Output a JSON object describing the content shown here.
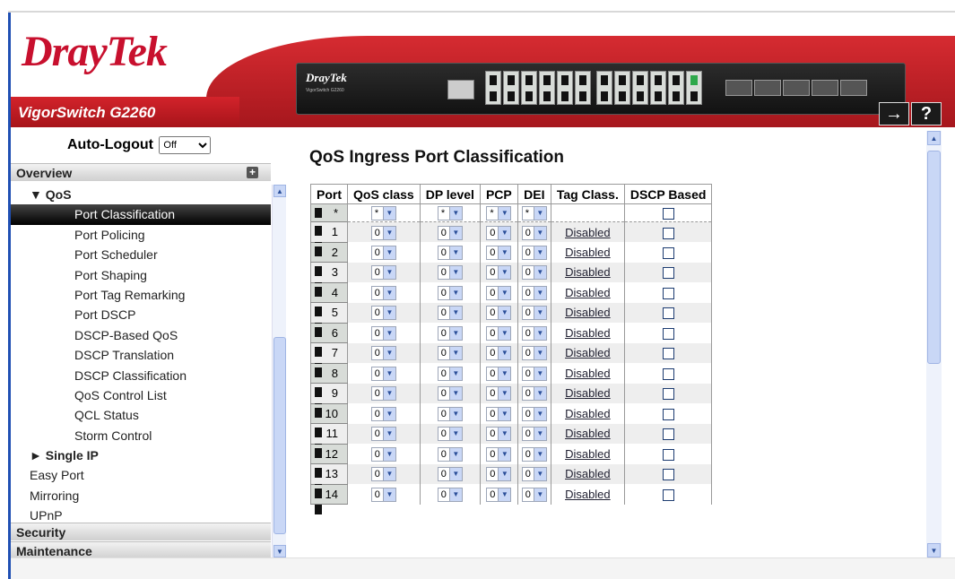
{
  "header": {
    "logo_dray": "Dray",
    "logo_tek": "Tek",
    "model": "VigorSwitch G2260",
    "device_brand": "DrayTek",
    "device_sub": "VigorSwitch G2260",
    "logout_icon": "→",
    "help_label": "?"
  },
  "nav": {
    "autologout_label": "Auto-Logout",
    "autologout_value": "Off",
    "overview_label": "Overview",
    "security_label": "Security",
    "maintenance_label": "Maintenance",
    "items": [
      {
        "label": "▼ QoS",
        "level": 1
      },
      {
        "label": "Port Classification",
        "level": 2,
        "active": true
      },
      {
        "label": "Port Policing",
        "level": 2
      },
      {
        "label": "Port Scheduler",
        "level": 2
      },
      {
        "label": "Port Shaping",
        "level": 2
      },
      {
        "label": "Port Tag Remarking",
        "level": 2
      },
      {
        "label": "Port DSCP",
        "level": 2
      },
      {
        "label": "DSCP-Based QoS",
        "level": 2
      },
      {
        "label": "DSCP Translation",
        "level": 2
      },
      {
        "label": "DSCP Classification",
        "level": 2
      },
      {
        "label": "QoS Control List",
        "level": 2
      },
      {
        "label": "QCL Status",
        "level": 2
      },
      {
        "label": "Storm Control",
        "level": 2
      },
      {
        "label": "► Single IP",
        "level": 1
      },
      {
        "label": "Easy Port",
        "level": 0
      },
      {
        "label": "Mirroring",
        "level": 0
      },
      {
        "label": "UPnP",
        "level": 0
      }
    ]
  },
  "main": {
    "title": "QoS Ingress Port Classification",
    "columns": [
      "Port",
      "QoS class",
      "DP level",
      "PCP",
      "DEI",
      "Tag Class.",
      "DSCP Based"
    ],
    "star_row": {
      "port": "*",
      "qos": "*",
      "dp": "*",
      "pcp": "*",
      "dei": "*"
    },
    "rows": [
      {
        "port": "1",
        "qos": "0",
        "dp": "0",
        "pcp": "0",
        "dei": "0",
        "tag": "Disabled"
      },
      {
        "port": "2",
        "qos": "0",
        "dp": "0",
        "pcp": "0",
        "dei": "0",
        "tag": "Disabled"
      },
      {
        "port": "3",
        "qos": "0",
        "dp": "0",
        "pcp": "0",
        "dei": "0",
        "tag": "Disabled"
      },
      {
        "port": "4",
        "qos": "0",
        "dp": "0",
        "pcp": "0",
        "dei": "0",
        "tag": "Disabled"
      },
      {
        "port": "5",
        "qos": "0",
        "dp": "0",
        "pcp": "0",
        "dei": "0",
        "tag": "Disabled"
      },
      {
        "port": "6",
        "qos": "0",
        "dp": "0",
        "pcp": "0",
        "dei": "0",
        "tag": "Disabled"
      },
      {
        "port": "7",
        "qos": "0",
        "dp": "0",
        "pcp": "0",
        "dei": "0",
        "tag": "Disabled"
      },
      {
        "port": "8",
        "qos": "0",
        "dp": "0",
        "pcp": "0",
        "dei": "0",
        "tag": "Disabled"
      },
      {
        "port": "9",
        "qos": "0",
        "dp": "0",
        "pcp": "0",
        "dei": "0",
        "tag": "Disabled"
      },
      {
        "port": "10",
        "qos": "0",
        "dp": "0",
        "pcp": "0",
        "dei": "0",
        "tag": "Disabled"
      },
      {
        "port": "11",
        "qos": "0",
        "dp": "0",
        "pcp": "0",
        "dei": "0",
        "tag": "Disabled"
      },
      {
        "port": "12",
        "qos": "0",
        "dp": "0",
        "pcp": "0",
        "dei": "0",
        "tag": "Disabled"
      },
      {
        "port": "13",
        "qos": "0",
        "dp": "0",
        "pcp": "0",
        "dei": "0",
        "tag": "Disabled"
      },
      {
        "port": "14",
        "qos": "0",
        "dp": "0",
        "pcp": "0",
        "dei": "0",
        "tag": "Disabled"
      }
    ]
  },
  "icons": {
    "dropdown": "chevron-down-icon",
    "expand": "plus-icon",
    "logout": "logout-icon",
    "help": "help-icon"
  },
  "colors": {
    "brand_red": "#c8102e",
    "nav_active": "#000000",
    "scroll_blue": "#c9d7f6"
  }
}
